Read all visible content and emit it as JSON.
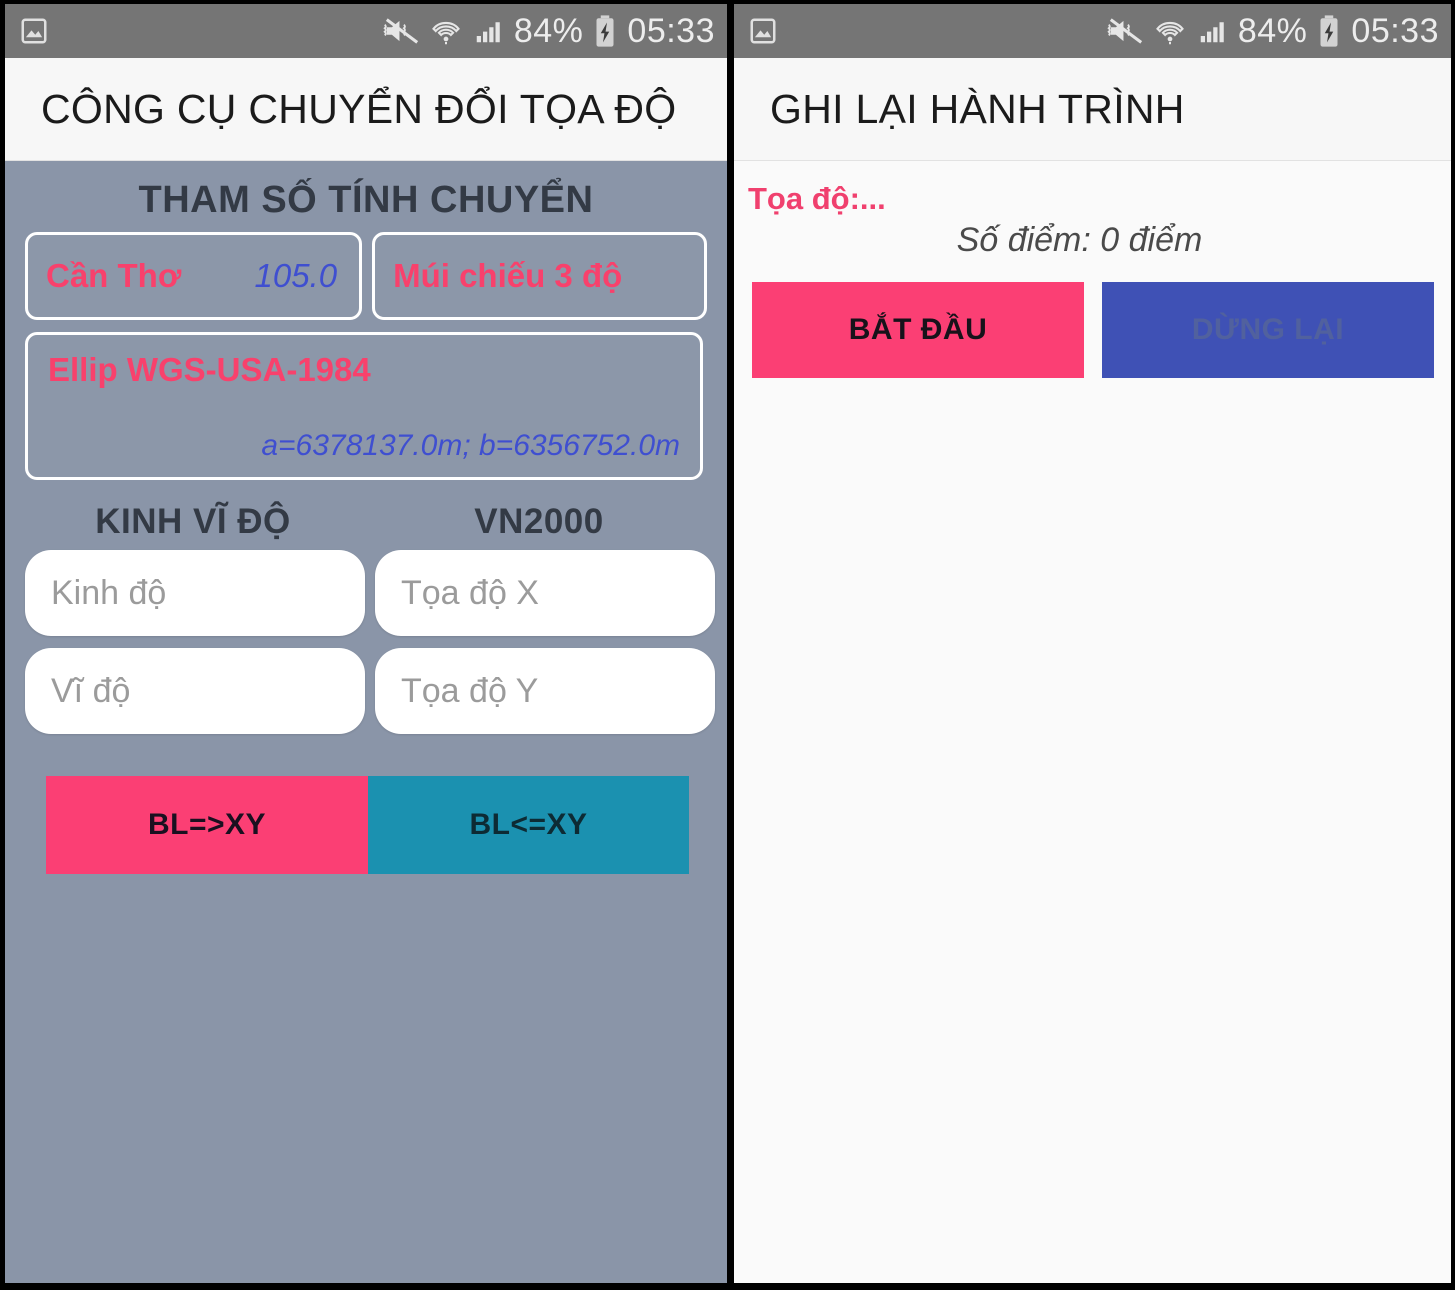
{
  "statusbar": {
    "notification_icon": "image-icon",
    "vibrate_icon": "mute-vibrate-icon",
    "wifi_icon": "wifi-icon",
    "signal_icon": "cellular-signal-icon",
    "battery_percent": "84%",
    "battery_icon": "battery-charging-icon",
    "time": "05:33"
  },
  "left_screen": {
    "appbar_title": "CÔNG CỤ CHUYỂN ĐỔI TỌA ĐỘ",
    "section_title": "THAM SỐ TÍNH CHUYỂN",
    "city": "Cần Thơ",
    "meridian_value": "105.0",
    "zone": "Múi chiếu 3 độ",
    "ellipsoid_name": "Ellip WGS-USA-1984",
    "ellipsoid_params": "a=6378137.0m; b=6356752.0m",
    "col_left_header": "KINH VĨ ĐỘ",
    "col_right_header": "VN2000",
    "fields": {
      "lon_placeholder": "Kinh độ",
      "lon_value": "",
      "lat_placeholder": "Vĩ độ",
      "lat_value": "",
      "x_placeholder": "Tọa độ X",
      "x_value": "",
      "y_placeholder": "Tọa độ Y",
      "y_value": ""
    },
    "btn_bl_to_xy": "BL=>XY",
    "btn_xy_to_bl": "BL<=XY"
  },
  "right_screen": {
    "appbar_title": "GHI LẠI HÀNH TRÌNH",
    "coord_label": "Tọa độ:...",
    "points_count": "Số điểm: 0 điểm",
    "btn_start": "BẮT ĐẦU",
    "btn_stop": "DỪNG LẠI"
  },
  "colors": {
    "pink": "#fb3f74",
    "teal": "#1b91b0",
    "indigo": "#3f51b5",
    "body_gray_blue": "#8a95a8",
    "statusbar_gray": "#757575",
    "appbar": "#f7f7f7",
    "accent_pink_text": "#f8416c",
    "accent_blue_text": "#3f4fd0"
  }
}
